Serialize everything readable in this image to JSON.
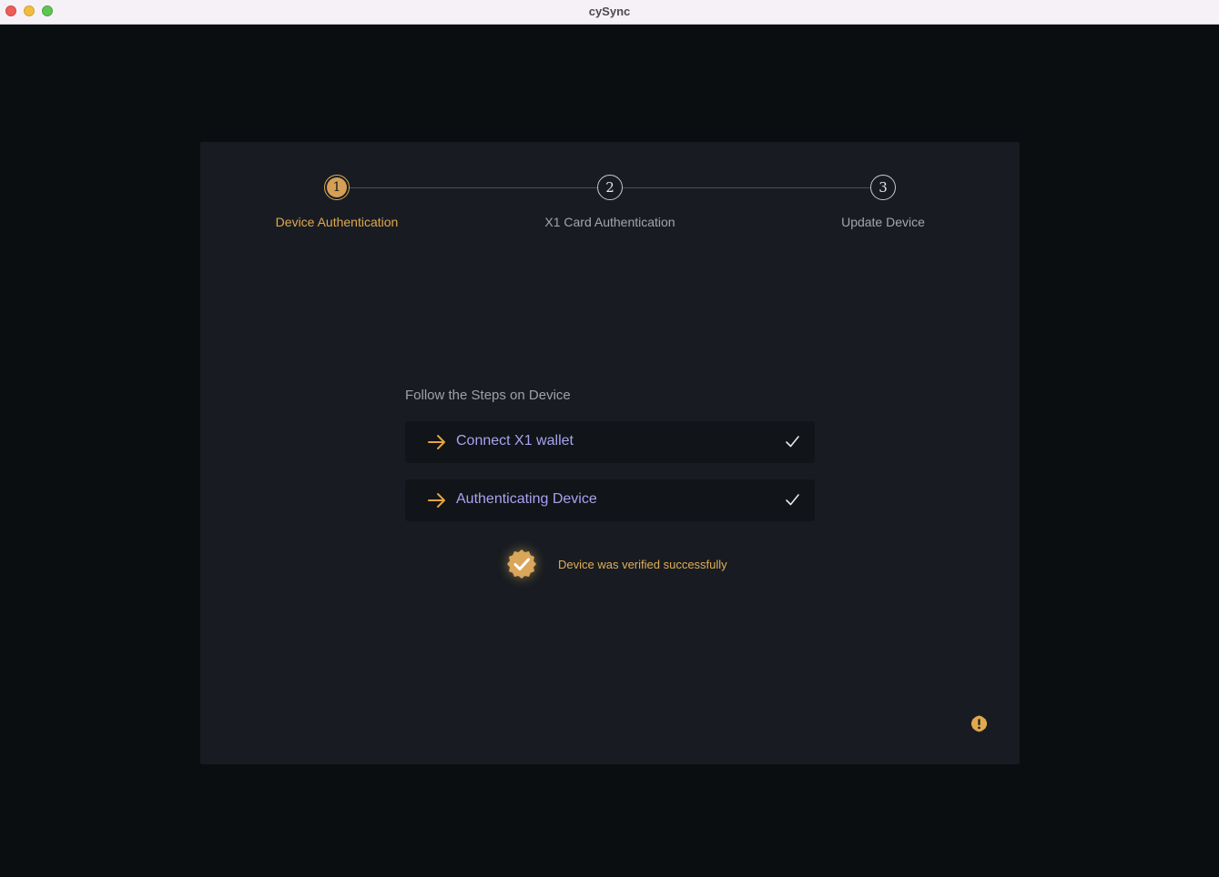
{
  "window": {
    "title": "cySync"
  },
  "stepper": {
    "steps": [
      {
        "number": "1",
        "label": "Device Authentication",
        "state": "active"
      },
      {
        "number": "2",
        "label": "X1 Card Authentication",
        "state": "pending"
      },
      {
        "number": "3",
        "label": "Update Device",
        "state": "pending"
      }
    ]
  },
  "main": {
    "heading": "Follow the Steps on Device",
    "actions": [
      {
        "label": "Connect X1 wallet",
        "icon": "arrow-right-icon",
        "status_icon": "checkmark-icon"
      },
      {
        "label": "Authenticating Device",
        "icon": "arrow-right-icon",
        "status_icon": "checkmark-icon"
      }
    ],
    "success_message": "Device was verified successfully",
    "success_icon": "verified-badge-icon"
  },
  "help": {
    "icon": "alert-icon"
  },
  "colors": {
    "accent": "#e1a84d",
    "action_text": "#a9a2f0",
    "panel": "#181c22",
    "background": "#0b0e11"
  }
}
